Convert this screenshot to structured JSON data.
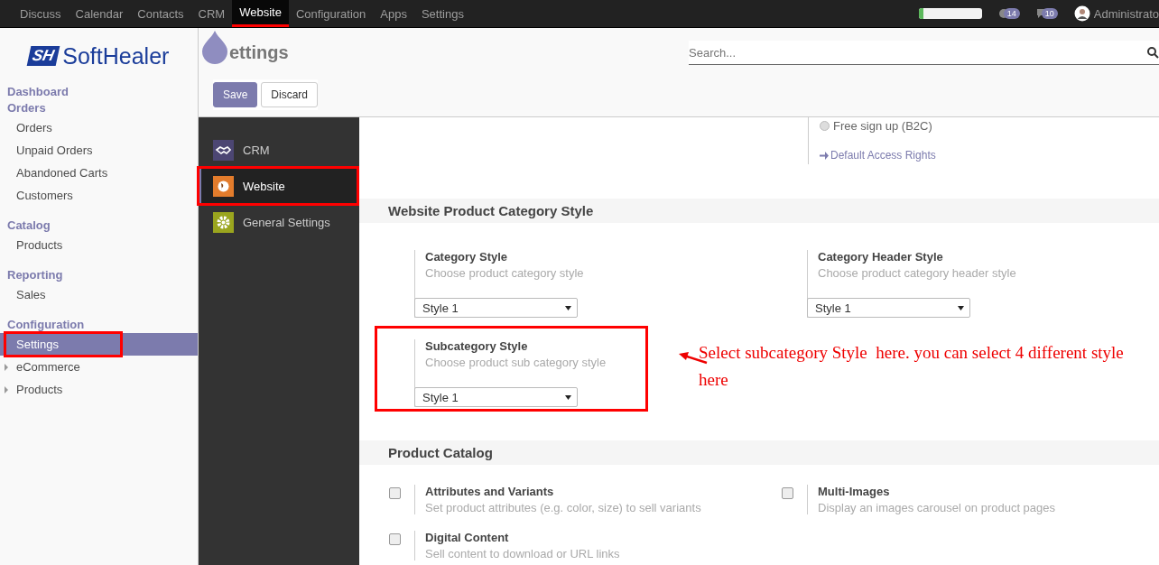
{
  "top_menu": [
    {
      "label": "Discuss",
      "selected": false,
      "annotated": false
    },
    {
      "label": "Calendar",
      "selected": false,
      "annotated": false
    },
    {
      "label": "Contacts",
      "selected": false,
      "annotated": false
    },
    {
      "label": "CRM",
      "selected": false,
      "annotated": false
    },
    {
      "label": "Website",
      "selected": true,
      "annotated": true
    },
    {
      "label": "Configuration",
      "selected": false,
      "annotated": false
    },
    {
      "label": "Apps",
      "selected": false,
      "annotated": false
    },
    {
      "label": "Settings",
      "selected": false,
      "annotated": false
    }
  ],
  "systray": {
    "progress": {
      "level": 0.07
    },
    "activity_count": "14",
    "message_count": "10",
    "user": "Administrato"
  },
  "logo": {
    "mark": "SH",
    "name": "SoftHealer"
  },
  "sidebar": [
    {
      "heading": "Dashboard"
    },
    {
      "heading": "Orders",
      "items": [
        {
          "label": "Orders",
          "selected": false,
          "annotated": false,
          "expandable": false
        },
        {
          "label": "Unpaid Orders",
          "selected": false,
          "annotated": false,
          "expandable": false
        },
        {
          "label": "Abandoned Carts",
          "selected": false,
          "annotated": false,
          "expandable": false
        },
        {
          "label": "Customers",
          "selected": false,
          "annotated": false,
          "expandable": false
        }
      ]
    },
    {
      "heading": "Catalog",
      "items": [
        {
          "label": "Products",
          "selected": false,
          "annotated": false,
          "expandable": false
        }
      ]
    },
    {
      "heading": "Reporting",
      "items": [
        {
          "label": "Sales",
          "selected": false,
          "annotated": false,
          "expandable": false
        }
      ]
    },
    {
      "heading": "Configuration",
      "items": [
        {
          "label": "Settings",
          "selected": true,
          "annotated": true,
          "expandable": false
        },
        {
          "label": "eCommerce",
          "selected": false,
          "annotated": false,
          "expandable": true
        },
        {
          "label": "Products",
          "selected": false,
          "annotated": false,
          "expandable": true
        }
      ]
    }
  ],
  "control_panel": {
    "title": "ettings",
    "search": {
      "placeholder": "Search..."
    },
    "buttons": [
      {
        "label": "Save",
        "kind": "primary"
      },
      {
        "label": "Discard",
        "kind": "secondary"
      }
    ]
  },
  "settings_apps": [
    {
      "label": "CRM",
      "kind": "crm",
      "selected": false,
      "annotated": false
    },
    {
      "label": "Website",
      "kind": "website",
      "selected": true,
      "annotated": true
    },
    {
      "label": "General Settings",
      "kind": "general",
      "selected": false,
      "annotated": false
    }
  ],
  "top_fragment": {
    "radio_label": "Free sign up (B2C)",
    "radio_selected": false,
    "link": "Default Access Rights"
  },
  "sections": [
    {
      "title": "Website Product Category Style",
      "settings": [
        {
          "kind": "select",
          "title": "Category Style",
          "help": "Choose product category style",
          "value": "Style 1",
          "annotated": false
        },
        {
          "kind": "select",
          "title": "Category Header Style",
          "help": "Choose product category header style",
          "value": "Style 1",
          "annotated": false
        },
        {
          "kind": "select",
          "title": "Subcategory Style",
          "help": "Choose product sub category style",
          "value": "Style 1",
          "annotated": true
        }
      ]
    },
    {
      "title": "Product Catalog",
      "settings": [
        {
          "kind": "checkbox",
          "title": "Attributes and Variants",
          "help": "Set product attributes (e.g. color, size) to sell variants",
          "checked": false
        },
        {
          "kind": "checkbox",
          "title": "Multi-Images",
          "help": "Display an images carousel on product pages",
          "checked": false
        },
        {
          "kind": "checkbox",
          "title": "Digital Content",
          "help": "Sell content to download or URL links",
          "checked": false
        }
      ]
    }
  ],
  "annotation": {
    "text": "Select subcategory Style  here. you can select 4 different style here"
  }
}
